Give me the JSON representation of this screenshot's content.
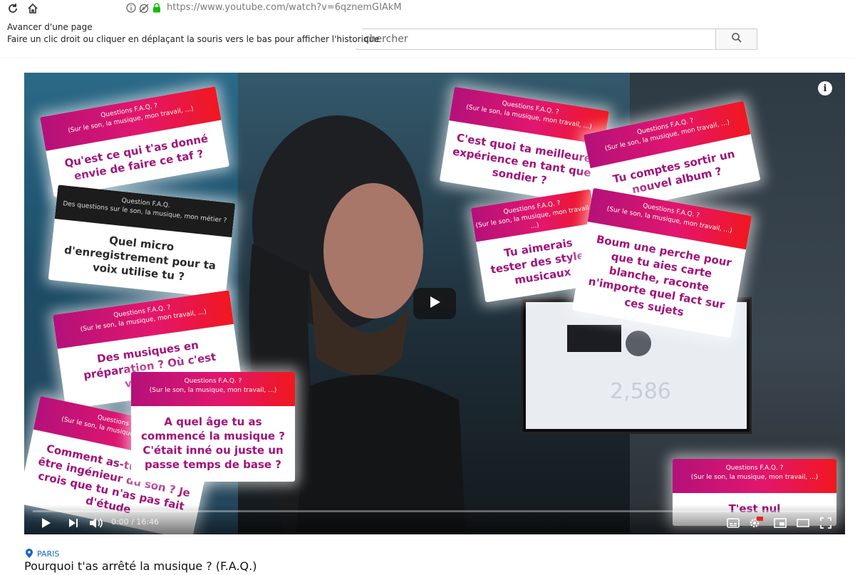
{
  "browser": {
    "url": "https://www.youtube.com/watch?v=6qznemGIAkM"
  },
  "tooltip": {
    "line1": "Avancer d'une page",
    "line2": "Faire un clic droit ou cliquer en déplaçant la souris vers le bas pour afficher l'historique"
  },
  "search": {
    "placeholder": "chercher"
  },
  "video": {
    "monitor_number": "2,586",
    "cards": [
      {
        "head1": "Questions F.A.Q. ?",
        "head2": "(Sur le son, la musique, mon travail, ...)",
        "body": "Qu'est ce qui t'as donné envie de faire ce taf ?"
      },
      {
        "head1": "Question F.A.Q.",
        "head2": "Des questions sur le son, la musique, mon métier ?",
        "body": "Quel micro d'enregistrement pour ta voix utilise tu ?"
      },
      {
        "head1": "Questions F.A.Q. ?",
        "head2": "(Sur le son, la musique, mon travail, ...)",
        "body": "Des musiques en préparation ? Où c'est vraiment"
      },
      {
        "head1": "Questions F.A.Q. ?",
        "head2": "(Sur le son, la musique, mon travail, ...)",
        "body": "A quel âge tu as commencé la musique ? C'était inné ou juste un passe temps de base ?"
      },
      {
        "head1": "Questions F.A.Q. ?",
        "head2": "(Sur le son, la musique, mon travail, ...)",
        "body": "Comment as-tu appris à être ingénieur du son ? Je crois que tu n'as pas fait d'étude"
      },
      {
        "head1": "Questions F.A.Q. ?",
        "head2": "(Sur le son, la musique, mon travail, ...)",
        "body": "C'est quoi ta meilleure expérience en tant que sondier ?"
      },
      {
        "head1": "Questions F.A.Q. ?",
        "head2": "(Sur le son, la musique, mon travail, ...)",
        "body": "Tu comptes sortir un nouvel album ?"
      },
      {
        "head1": "Questions F.A.Q. ?",
        "head2": "(Sur le son, la musique, mon travail, ...)",
        "body": "Tu aimerais tester des styles musicaux"
      },
      {
        "head1": "Questions F.A.Q. ?",
        "head2": "(Sur le son, la musique, mon travail, ...)",
        "body": "Boum une perche pour que tu aies carte blanche, raconte n'importe quel fact sur ces sujets"
      },
      {
        "head1": "Questions F.A.Q. ?",
        "head2": "(Sur le son, la musique, mon travail, ...)",
        "body": "T'est nul"
      }
    ],
    "time_current": "0:00",
    "time_sep": " / ",
    "time_total": "16:46",
    "progress": 0.0
  },
  "location": "PARIS",
  "title": "Pourquoi t'as arrêté la musique ? (F.A.Q.)"
}
